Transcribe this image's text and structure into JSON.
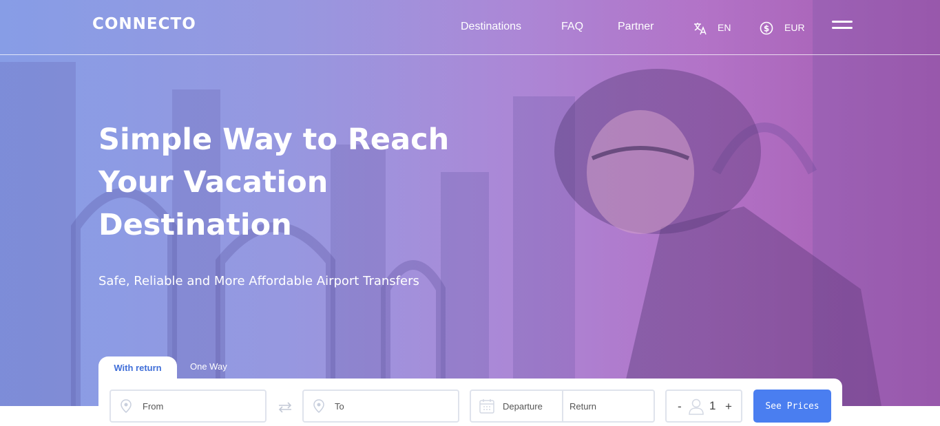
{
  "brand": {
    "logo_text": "CONNECTO"
  },
  "nav": {
    "links": [
      "Destinations",
      "FAQ",
      "Partner"
    ],
    "language": "EN",
    "currency": "EUR",
    "icons": {
      "language": "translate-icon",
      "currency": "dollar-coin-icon",
      "menu": "hamburger-menu-icon"
    }
  },
  "hero": {
    "headline_lines": [
      "Simple Way to Reach",
      "Your Vacation",
      "Destination"
    ],
    "subheadline": "Safe, Reliable and More Affordable Airport Transfers"
  },
  "search": {
    "tabs": {
      "active": "With return",
      "inactive": "One Way"
    },
    "from_placeholder": "From",
    "to_placeholder": "To",
    "departure_placeholder": "Departure",
    "return_placeholder": "Return",
    "passengers": {
      "minus": "-",
      "count": "1",
      "plus": "+"
    },
    "submit_label": "See Prices"
  },
  "colors": {
    "accent": "#4a7ef0",
    "tab_text": "#3f6ed8",
    "field_border": "#dfe3ec"
  }
}
